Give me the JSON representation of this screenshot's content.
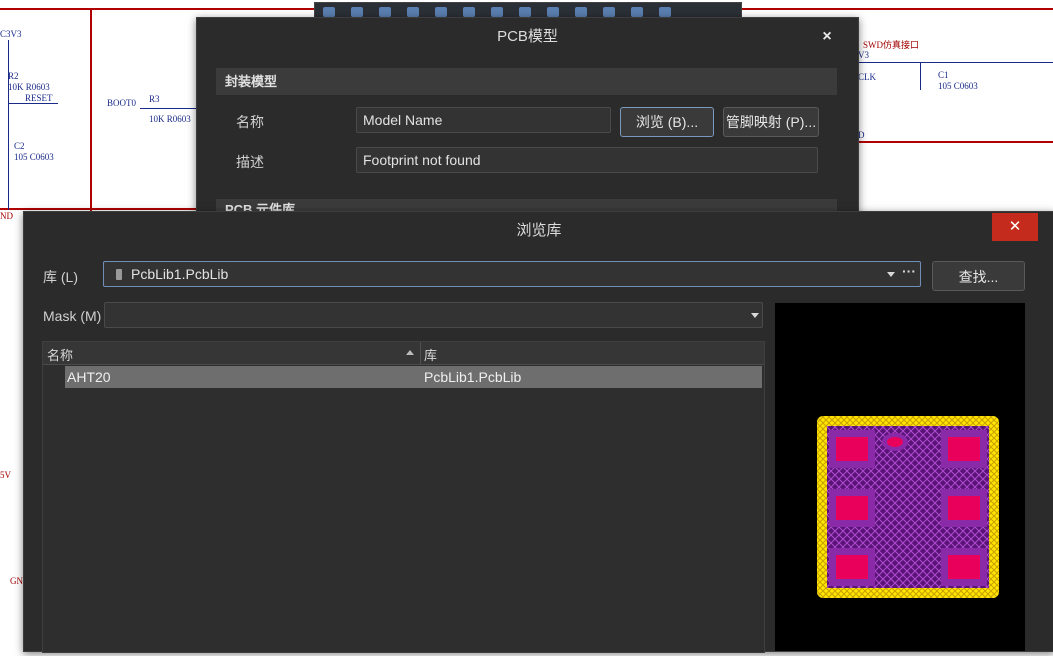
{
  "schematic": {
    "labels_blue": [
      "C3V3",
      "R2",
      "10K R0603",
      "RESET",
      "C2",
      "105 C0603",
      "BOOT0",
      "R3",
      "10K R0603",
      "C1",
      "105 C0603",
      "CLK",
      "V3",
      "D"
    ],
    "labels_red": [
      "SWD仿真接口",
      "ND",
      "5V",
      "GN"
    ]
  },
  "pcb_dialog": {
    "title": "PCB模型",
    "close": "×",
    "section_footprint": "封装模型",
    "name_label": "名称",
    "name_value": "Model Name",
    "desc_label": "描述",
    "desc_value": "Footprint not found",
    "browse_button": "浏览 (B)...",
    "pinmap_button": "管脚映射 (P)...",
    "section_library": "PCB 元件库"
  },
  "browse_dialog": {
    "title": "浏览库",
    "close": "✕",
    "library_label": "库 (L)",
    "library_value": "PcbLib1.PcbLib",
    "more": "···",
    "find_button": "查找...",
    "mask_label": "Mask (M)",
    "mask_value": "",
    "columns": [
      "名称",
      "库"
    ],
    "rows": [
      {
        "name": "AHT20",
        "library": "PcbLib1.PcbLib"
      }
    ]
  },
  "colors": {
    "dialog_bg": "#2b2b2b",
    "selected_row": "#6e6e6e",
    "close_red": "#c42b1c",
    "pad_color": "#e8005a",
    "outline_yellow": "#ffe600",
    "body_purple": "#7a1f9c"
  }
}
